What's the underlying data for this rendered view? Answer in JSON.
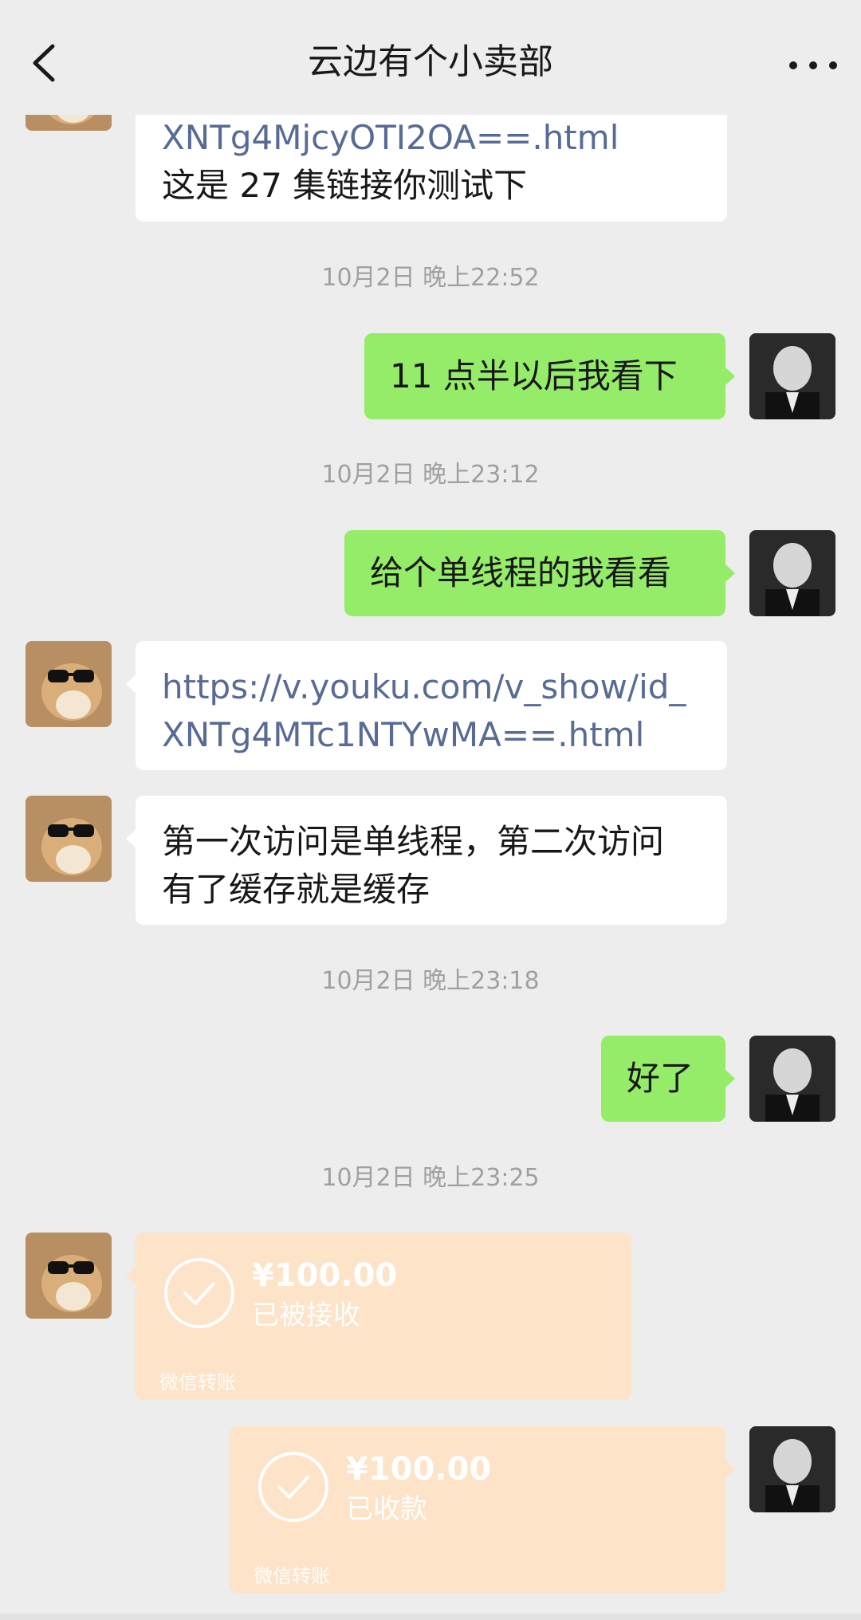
{
  "header": {
    "back_icon": "chevron-left-icon",
    "title": "云边有个小卖部",
    "more_icon": "more-horizontal-icon"
  },
  "messages": [
    {
      "side": "left",
      "lines": [
        "XNTg4MjcyOTI2OA==.html",
        "这是 27 集链接你测试下"
      ]
    },
    {
      "time": "10月2日 晚上22:52"
    },
    {
      "side": "right",
      "text": "11 点半以后我看下"
    },
    {
      "time": "10月2日 晚上23:12"
    },
    {
      "side": "right",
      "text": "给个单线程的我看看"
    },
    {
      "side": "left",
      "lines": [
        "https://v.youku.com/v_show/id_",
        "XNTg4MTc1NTYwMA==.html"
      ]
    },
    {
      "side": "left",
      "lines": [
        "第一次访问是单线程，第二次访问",
        "有了缓存就是缓存"
      ]
    },
    {
      "time": "10月2日 晚上23:18"
    },
    {
      "side": "right",
      "text": "好了"
    },
    {
      "time": "10月2日 晚上23:25"
    },
    {
      "side": "left",
      "transfer": {
        "amount": "¥100.00",
        "status": "已被接收",
        "label": "微信转账"
      }
    },
    {
      "side": "right",
      "transfer": {
        "amount": "¥100.00",
        "status": "已收款",
        "label": "微信转账"
      }
    }
  ],
  "colors": {
    "background": "#ededed",
    "bubble_self": "#95ec69",
    "bubble_other": "#ffffff",
    "link": "#576b95",
    "transfer": "#fde3c8",
    "timestamp": "#a0a0a0"
  }
}
